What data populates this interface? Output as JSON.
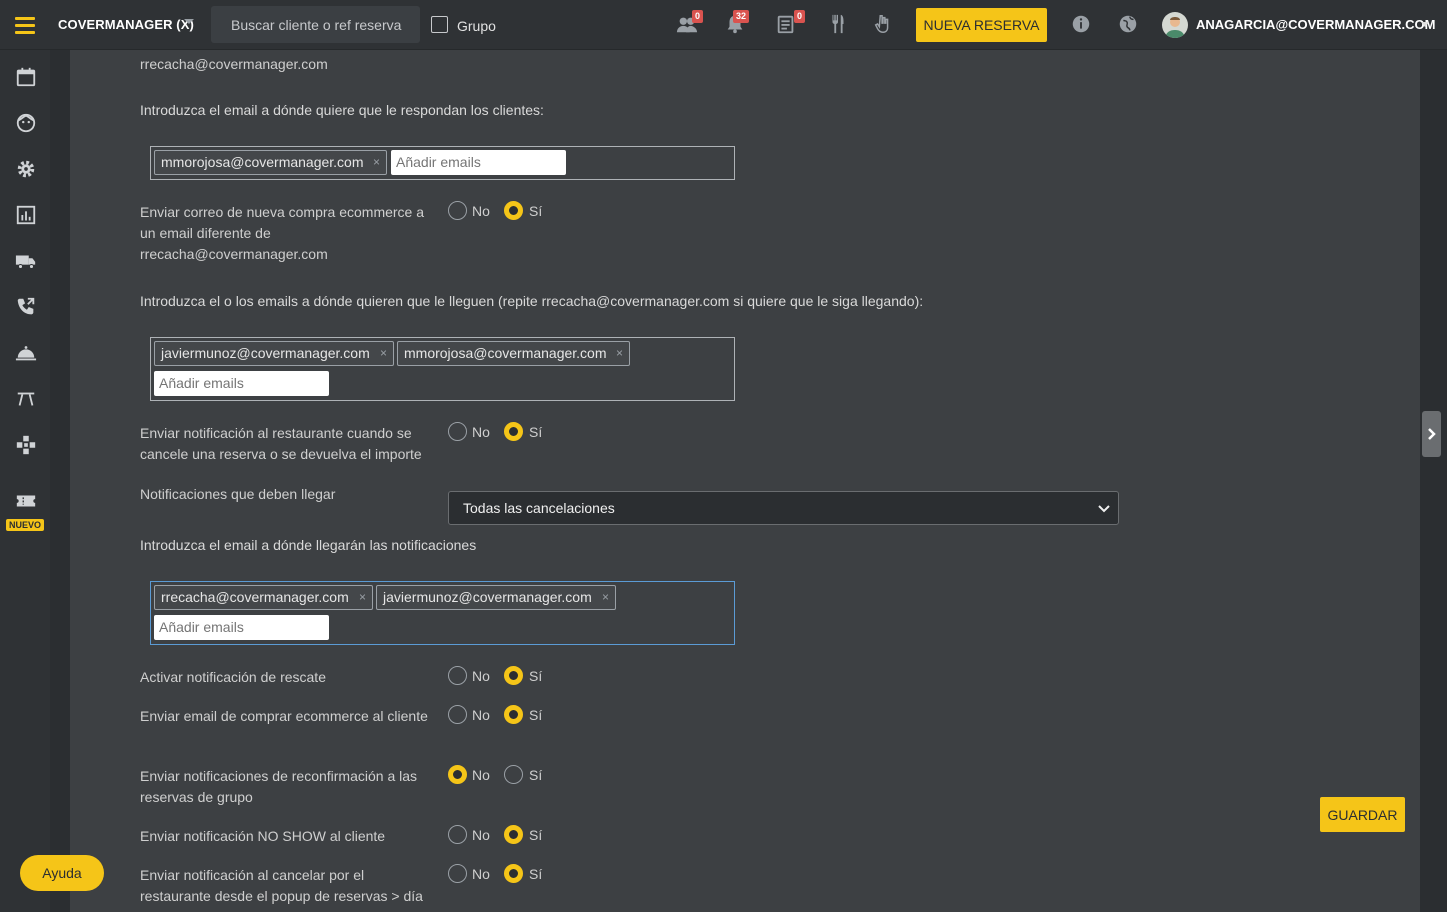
{
  "topbar": {
    "brand": "COVERMANAGER (X)",
    "search_placeholder": "Buscar cliente o ref reserva",
    "grupo_label": "Grupo",
    "badges": {
      "people": "0",
      "bell": "32",
      "tasks": "0"
    },
    "new_reservation": "NUEVA RESERVA",
    "user_email": "ANAGARCIA@COVERMANAGER.COM",
    "icons": [
      "people-icon",
      "bell-icon",
      "tasks-icon",
      "cutlery-icon",
      "hand-icon",
      "info-icon",
      "globe-icon"
    ]
  },
  "sidebar": {
    "items": [
      "calendar-icon",
      "face-icon",
      "gear-icon",
      "chart-icon",
      "truck-icon",
      "phone-icon",
      "cloche-icon",
      "table-icon",
      "plugin-icon",
      "ticket-icon"
    ],
    "new_badge": "NUEVO"
  },
  "form": {
    "top_email": "rrecacha@covermanager.com",
    "reply_to_prompt": "Introduzca el email a dónde quiere que le respondan los clientes:",
    "reply_to_tags": [
      "mmorojosa@covermanager.com"
    ],
    "add_emails_placeholder": "Añadir emails",
    "ecommerce_diff_label": "Enviar correo de nueva compra ecommerce a un email diferente de rrecacha@covermanager.com",
    "ecommerce_prompt": "Introduzca el o los emails a dónde quieren que le lleguen (repite rrecacha@covermanager.com si quiere que le siga llegando):",
    "ecommerce_tags": [
      "javiermunoz@covermanager.com",
      "mmorojosa@covermanager.com"
    ],
    "cancel_notify_label": "Enviar notificación al restaurante cuando se cancele una reserva o se devuelva el importe",
    "notif_types_label": "Notificaciones que deben llegar",
    "notif_types_value": "Todas las cancelaciones",
    "notif_email_prompt": "Introduzca el email a dónde llegarán las notificaciones",
    "notif_tags": [
      "rrecacha@covermanager.com",
      "javiermunoz@covermanager.com"
    ],
    "rescue_label": "Activar notificación de rescate",
    "ecommerce_client_label": "Enviar email de comprar ecommerce al cliente",
    "reconfirm_group_label": "Enviar notificaciones de reconfirmación a las reservas de grupo",
    "noshow_label": "Enviar notificación NO SHOW al cliente",
    "cancel_popup_label": "Enviar notificación al cancelar por el restaurante desde el popup de reservas > día",
    "no": "No",
    "yes": "Sí",
    "selections": {
      "ecommerce_diff": "Sí",
      "cancel_notify": "Sí",
      "rescue": "Sí",
      "ecommerce_client": "Sí",
      "reconfirm_group": "No",
      "noshow": "Sí",
      "cancel_popup": "Sí"
    }
  },
  "buttons": {
    "save": "GUARDAR",
    "help": "Ayuda"
  },
  "colors": {
    "accent": "#f5c518",
    "background": "#2b2e31",
    "panel": "#3d4043",
    "badge": "#d9534f"
  }
}
